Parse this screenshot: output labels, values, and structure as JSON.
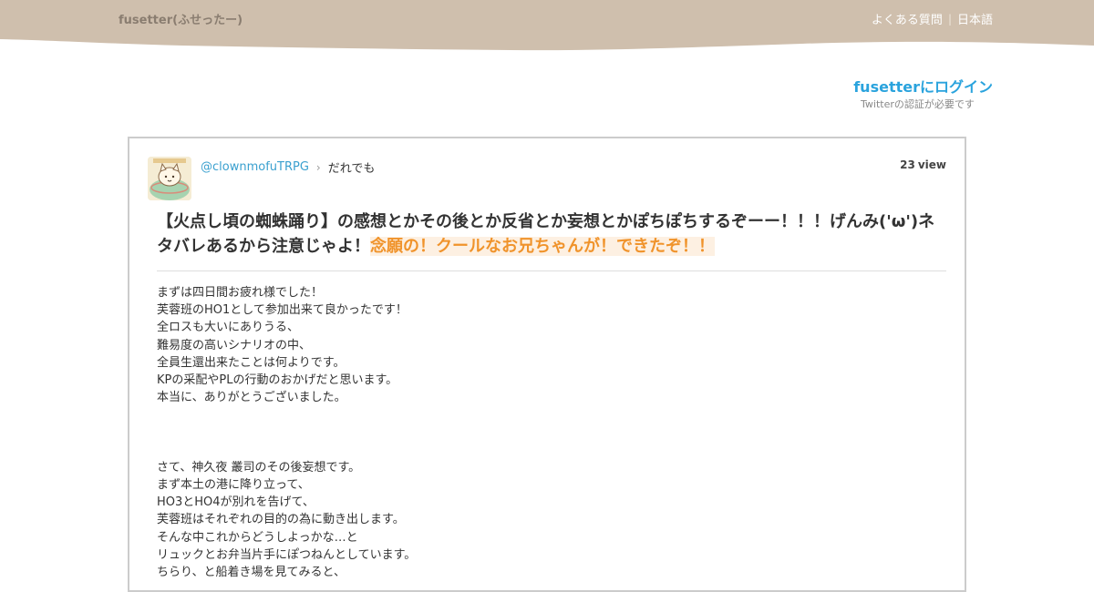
{
  "header": {
    "brand": "fusetter(ふせったー)",
    "nav": [
      "よくある質問",
      "日本語"
    ],
    "nav_separator": "|"
  },
  "login": {
    "link_label": "fusetterにログイン",
    "note": "Twitterの認証が必要です"
  },
  "post": {
    "author_handle": "@clownmofuTRPG",
    "audience": "だれでも",
    "view_count": "23",
    "view_unit": "view",
    "title_main": "【火点し頃の蜘蛛踊り】の感想とかその後とか反省とか妄想とかぽちぽちするぞーー！！！げんみ('ω')ネタバレあるから注意じゃよ！",
    "title_highlight": "念願の！クールなお兄ちゃんが！できたぞ！！",
    "body_lines": [
      "まずは四日間お疲れ様でした！",
      "芙蓉班のHO1として参加出来て良かったです！",
      "全ロスも大いにありうる、",
      "難易度の高いシナリオの中、",
      "全員生還出来たことは何よりです。",
      "KPの采配やPLの行動のおかげだと思います。",
      "本当に、ありがとうございました。",
      "",
      "",
      "",
      "さて、神久夜 叢司のその後妄想です。",
      "まず本土の港に降り立って、",
      "HO3とHO4が別れを告げて、",
      "芙蓉班はそれぞれの目的の為に動き出します。",
      "そんな中これからどうしよっかな…と",
      "リュックとお弁当片手にぽつねんとしています。",
      "ちらり、と船着き場を見てみると、"
    ]
  },
  "colors": {
    "topbar": "#cfbfad",
    "login_band": "#f2f2f2",
    "link": "#2aa3dd",
    "highlight": "#f0932b"
  },
  "icons": {
    "view_chevron": "chevron-right-icon",
    "avatar": "cat-avatar-icon"
  }
}
